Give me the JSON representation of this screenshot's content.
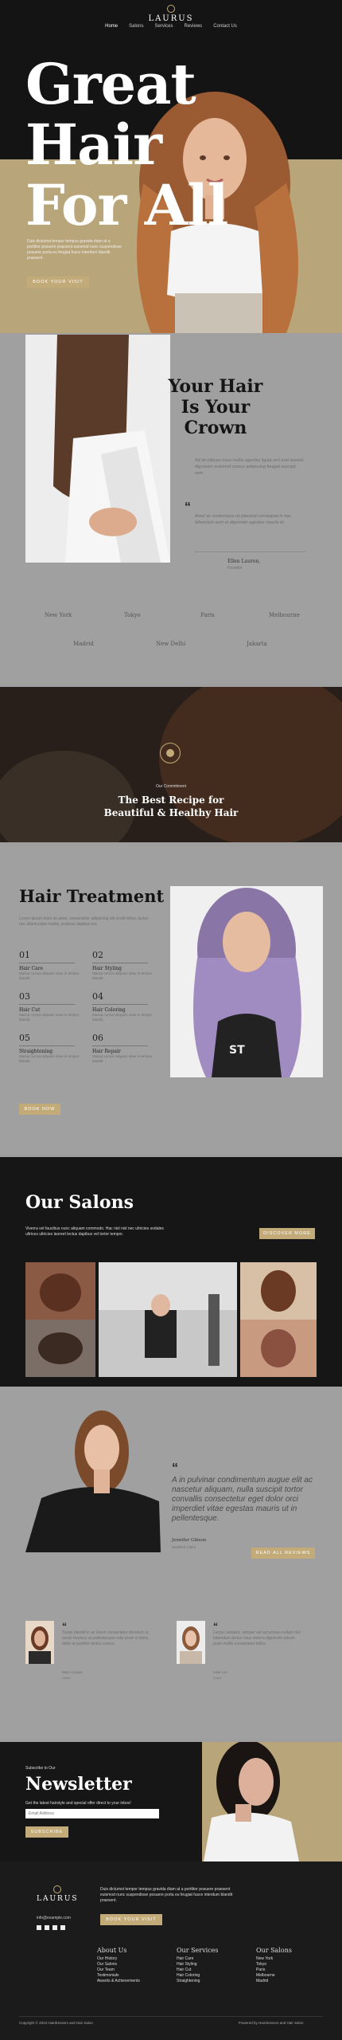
{
  "brand": {
    "name": "LAURUS"
  },
  "nav": {
    "items": [
      "Home",
      "Salons",
      "Services",
      "Reviews",
      "Contact Us"
    ]
  },
  "hero": {
    "title_line1": "Great",
    "title_line2": "Hair",
    "title_line3": "For All",
    "text": "Duis dictumst tempor tempus gravida diam at a porttitor posuere praesent euismod nunc suspendisse posuere porta eu feugiat fusce interdum blandit praesent.",
    "button": "Book Your Visit"
  },
  "crown": {
    "title_line1": "Your Hair",
    "title_line2": "Is Your",
    "title_line3": "Crown",
    "text": "Ad sit ultrices risus mollis egestas ligula orci erat laoreet dignissim euismod cursus adipiscing feugiat suscipit sem.",
    "quote": "Amet ac scelerisque mi placerat consequat in hac bibendum sem et dignissim egestas mauris id.",
    "author_name": "Ellen Lauren,",
    "author_role": "Founder"
  },
  "cities": {
    "row1": [
      "New York",
      "Tokyo",
      "Paris",
      "Melbourne"
    ],
    "row2": [
      "Madrid",
      "New Delhi",
      "Jakarta"
    ]
  },
  "recipe": {
    "eyebrow": "Our Commitment",
    "title_line1": "The Best Recipe for",
    "title_line2": "Beautiful & Healthy Hair"
  },
  "treatment": {
    "title": "Hair Treatment",
    "text": "Lorem ipsum dolor sit amet, consectetur adipiscing elit ut elit tellus, luctus nec ullamcorper mattis, pulvinar dapibus leo.",
    "items": [
      {
        "num": "01",
        "name": "Hair Care",
        "desc": "Massa cursus aliquam vitae in tempor blandit."
      },
      {
        "num": "02",
        "name": "Hair Styling",
        "desc": "Massa cursus aliquam vitae in tempor blandit."
      },
      {
        "num": "03",
        "name": "Hair Cut",
        "desc": "Massa cursus aliquam vitae in tempor blandit."
      },
      {
        "num": "04",
        "name": "Hair Coloring",
        "desc": "Massa cursus aliquam vitae in tempor blandit."
      },
      {
        "num": "05",
        "name": "Straightening",
        "desc": "Massa cursus aliquam vitae in tempor blandit."
      },
      {
        "num": "06",
        "name": "Hair Repair",
        "desc": "Massa cursus aliquam vitae in tempor blandit."
      }
    ],
    "button": "Book Now"
  },
  "salons": {
    "title": "Our Salons",
    "text": "Viverra vel faucibus nunc aliquam commodo. Hac nisl nisl nec ultricies sodales ultrices ultricies laoreet lectus dapibus vel tortor tempor.",
    "button": "Discover More"
  },
  "reviews": {
    "quote": "A in pulvinar condimentum augue elit ac nascetur aliquam, nulla suscipit tortor convallis consectetur eget dolor orci imperdiet vitae egestas mauris ut in pellentesque.",
    "author": "Jennifer Gibson",
    "author_role": "Satisfied Client",
    "button": "Read All Reviews",
    "small": [
      {
        "quote": "Turpis blandit in ac lorem consectetur tincidunt ut morbi rhoncus et pellentesque odio proin in litora, dolor et porttitor lectus cursus.",
        "name": "Mary Cooper",
        "role": "Client"
      },
      {
        "quote": "Lectus sodales, semper vel accumsan nullam nisl bibendum lectus risus viverra dignissim rutrum proin mollis consectetur tellus.",
        "name": "Kate Lee",
        "role": "Client"
      }
    ]
  },
  "newsletter": {
    "eyebrow": "Subscribe to Our",
    "title": "Newsletter",
    "text": "Get the latest hairstyle and special offer direct to your inbox!",
    "placeholder": "Email Address",
    "button": "Subscribe"
  },
  "footer": {
    "text": "Duis dictumst tempor tempus gravida diam at a porttitor posuere praesent euismod nunc suspendisse posuere porta eu feugiat fusce interdum blandit praesent.",
    "email": "info@example.com",
    "button": "Book Your Visit",
    "col1_title": "About Us",
    "col1": [
      "Our History",
      "Our Salons",
      "Our Team",
      "Testimonials",
      "Awards & Achievements"
    ],
    "col2_title": "Our Services",
    "col2": [
      "Hair Care",
      "Hair Styling",
      "Hair Cut",
      "Hair Coloring",
      "Straightening"
    ],
    "col3_title": "Our Salons",
    "col3": [
      "New York",
      "Tokyo",
      "Paris",
      "Melbourne",
      "Madrid"
    ],
    "copyright": "Copyright © 2024 Hairdressers and Hair Salon",
    "powered": "Powered by Hairdressers and Hair Salon"
  }
}
